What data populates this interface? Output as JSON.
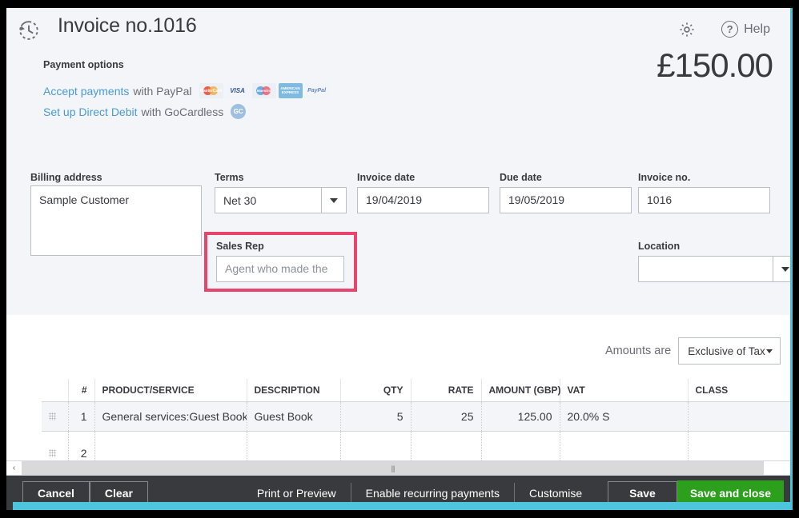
{
  "header": {
    "history_icon": "history-clock-icon",
    "title": "Invoice no.1016",
    "gear_icon": "gear-icon",
    "help_icon": "question-circle-icon",
    "help_label": "Help",
    "total_amount": "£150.00"
  },
  "payment_options": {
    "label": "Payment options",
    "paypal_link": "Accept payments",
    "paypal_suffix": "with PayPal",
    "gocardless_link": "Set up Direct Debit",
    "gocardless_suffix": "with GoCardless",
    "badges": [
      {
        "name": "mastercard-badge",
        "label": "MasterCard"
      },
      {
        "name": "visa-badge",
        "label": "VISA"
      },
      {
        "name": "maestro-badge",
        "label": "Maestro"
      },
      {
        "name": "amex-badge",
        "label": "AMERICAN EXPRESS"
      },
      {
        "name": "paypal-badge",
        "label": "PayPal"
      }
    ],
    "gocardless_badge": "GC"
  },
  "form": {
    "billing_address": {
      "label": "Billing address",
      "value": "Sample Customer"
    },
    "terms": {
      "label": "Terms",
      "value": "Net 30"
    },
    "invoice_date": {
      "label": "Invoice date",
      "value": "19/04/2019"
    },
    "due_date": {
      "label": "Due date",
      "value": "19/05/2019"
    },
    "invoice_no": {
      "label": "Invoice no.",
      "value": "1016"
    },
    "sales_rep": {
      "label": "Sales Rep",
      "placeholder": "Agent who made the sale",
      "value": ""
    },
    "location": {
      "label": "Location",
      "value": ""
    }
  },
  "highlight_color": "#e8456c",
  "amounts": {
    "label": "Amounts are",
    "selected": "Exclusive of Tax"
  },
  "line_items": {
    "columns": [
      "",
      "#",
      "PRODUCT/SERVICE",
      "DESCRIPTION",
      "QTY",
      "RATE",
      "AMOUNT (GBP)",
      "VAT",
      "CLASS"
    ],
    "rows": [
      {
        "num": "1",
        "product_service": "General services:Guest Book",
        "description": "Guest Book",
        "qty": "5",
        "rate": "25",
        "amount": "125.00",
        "vat": "20.0% S",
        "class": ""
      },
      {
        "num": "2",
        "product_service": "",
        "description": "",
        "qty": "",
        "rate": "",
        "amount": "",
        "vat": "",
        "class": ""
      }
    ]
  },
  "scrollbar": {
    "left_arrow": "‹",
    "grip": "|||"
  },
  "toolbar": {
    "cancel": "Cancel",
    "clear": "Clear",
    "print_or_preview": "Print or Preview",
    "enable_recurring": "Enable recurring payments",
    "customise": "Customise",
    "save": "Save",
    "save_and_close": "Save and close",
    "save_close_color": "#2ca01c"
  }
}
